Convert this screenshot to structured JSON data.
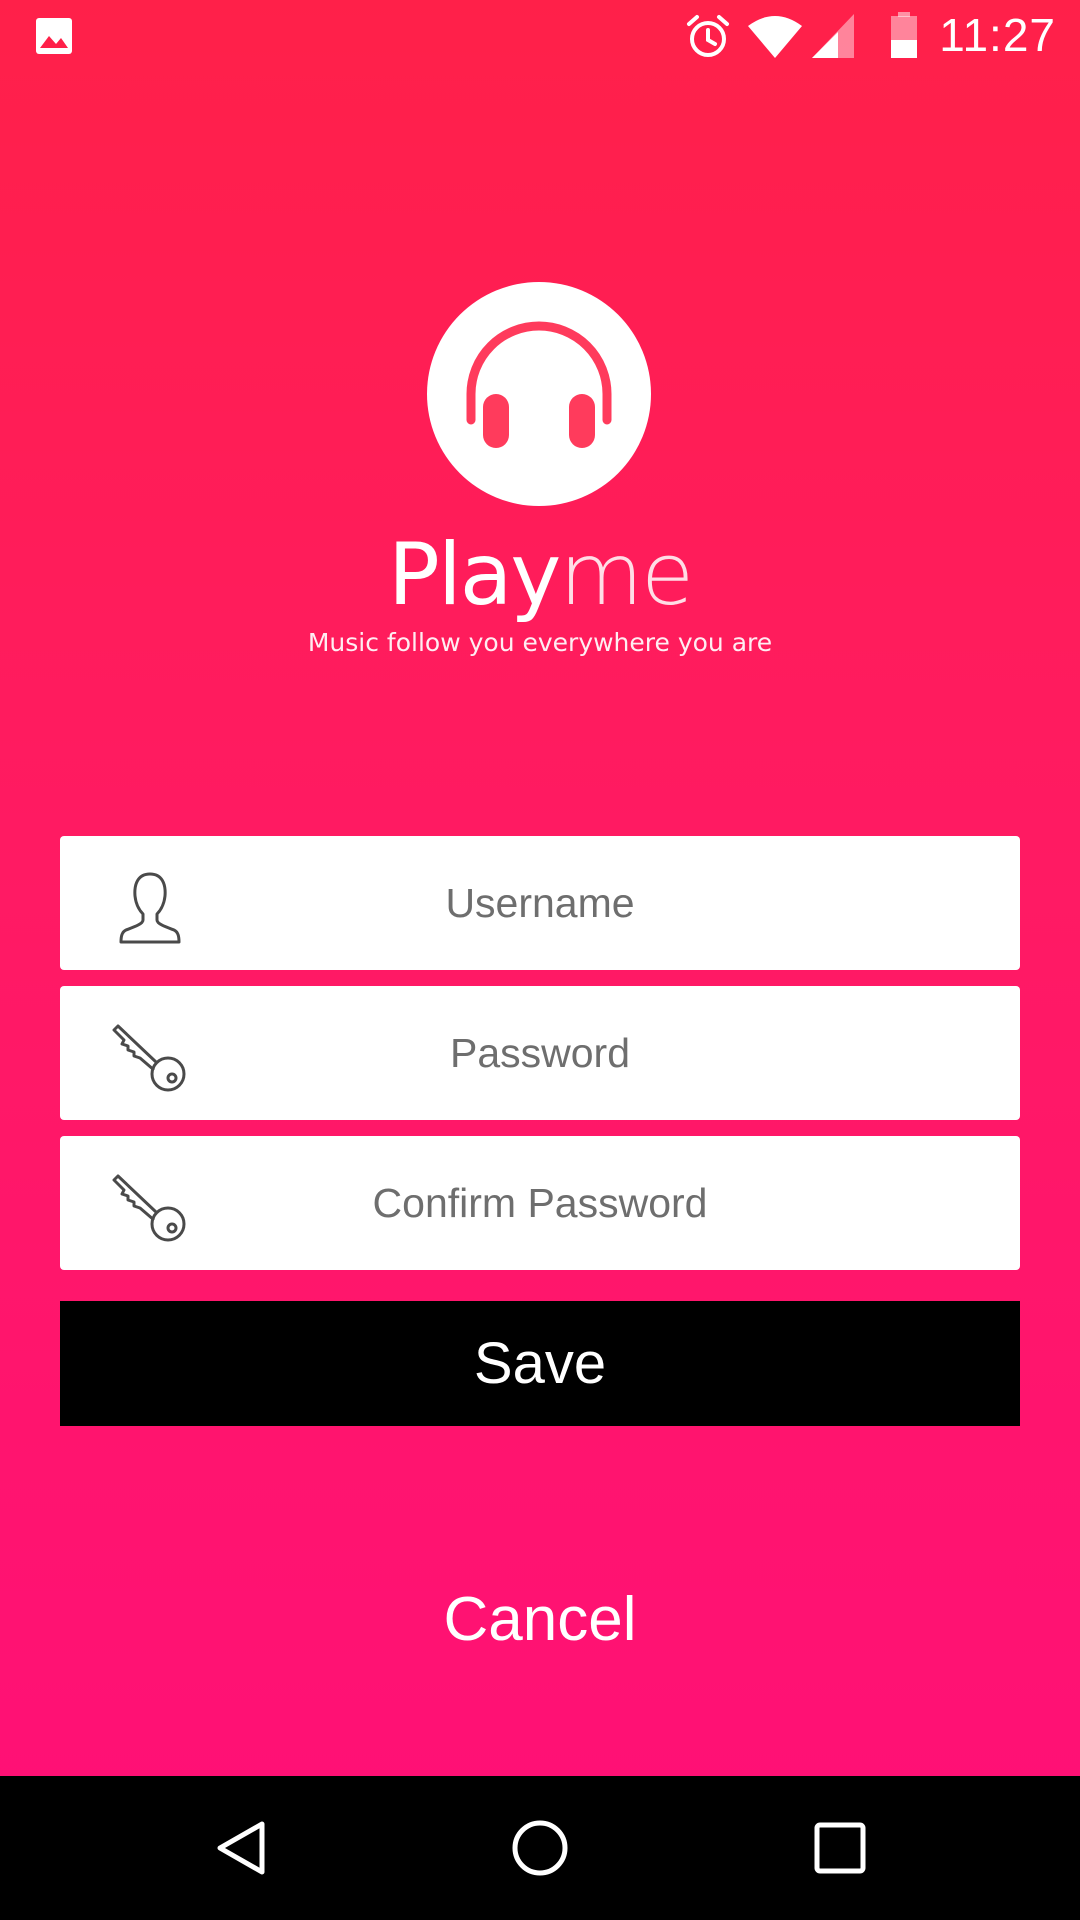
{
  "status_bar": {
    "time": "11:27",
    "icons": [
      "image-notification-icon",
      "alarm-icon",
      "wifi-icon",
      "cell-signal-icon",
      "battery-icon"
    ]
  },
  "app": {
    "brand_part1": "Play",
    "brand_part2": "me",
    "tagline": "Music follow you everywhere you are",
    "logo_icon": "headphones-icon"
  },
  "form": {
    "username_placeholder": "Username",
    "password_placeholder": "Password",
    "confirm_password_placeholder": "Confirm Password",
    "save_label": "Save",
    "cancel_label": "Cancel"
  },
  "nav_bar": {
    "icons": [
      "back-icon",
      "home-icon",
      "recents-icon"
    ]
  },
  "colors": {
    "background_top": "#ff2049",
    "background_bottom": "#ff0f78",
    "logo_accent": "#ff3b5c",
    "save_button": "#000000"
  }
}
